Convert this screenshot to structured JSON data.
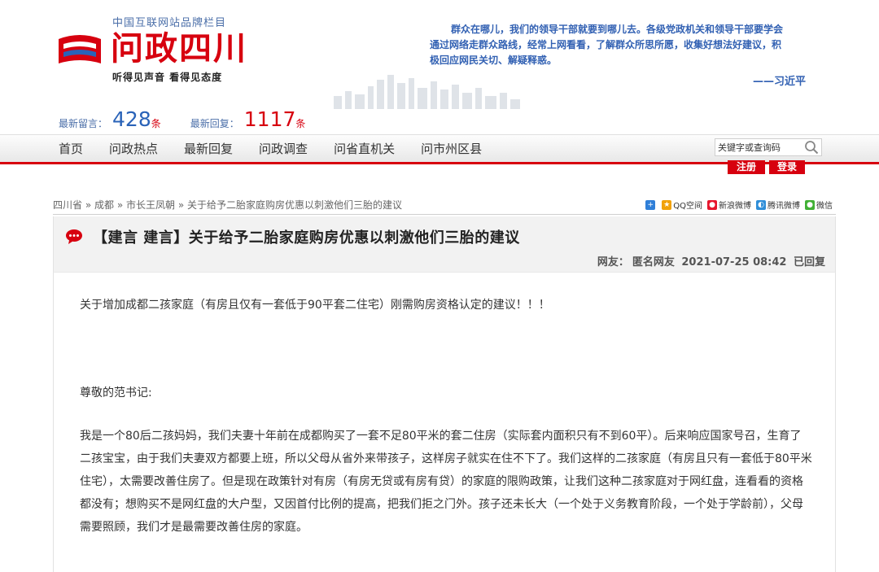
{
  "header": {
    "tagline_top": "中国互联网站品牌栏目",
    "logo_text": "问政四川",
    "slogan": "听得见声音  看得见态度",
    "quote_lines": [
      "群众在哪儿，我们的领导干部就要到哪儿去。各级党政机关和领导干部要学会",
      "通过网络走群众路线，经常上网看看，了解群众所思所愿，收集好想法好建议，积",
      "极回应网民关切、解疑释惑。"
    ],
    "quote_author": "——习近平",
    "stats": [
      {
        "label": "最新留言：",
        "value": "428",
        "unit": "条"
      },
      {
        "label": "最新回复：",
        "value": "1117",
        "unit": "条"
      }
    ]
  },
  "nav": {
    "items": [
      "首页",
      "问政热点",
      "最新回复",
      "问政调查",
      "问省直机关",
      "问市州区县"
    ],
    "search_placeholder": "关键字或查询码",
    "register_label": "注册",
    "login_label": "登录"
  },
  "breadcrumb": {
    "items": [
      "四川省",
      "成都",
      "市长王凤朝",
      "关于给予二胎家庭购房优惠以刺激他们三胎的建议"
    ],
    "separator": "»"
  },
  "share": {
    "items": [
      {
        "label": "",
        "color": "#2f7fd8",
        "icon": "plus-icon"
      },
      {
        "label": "QQ空间",
        "color": "#f1a20b",
        "icon": "qzone-icon"
      },
      {
        "label": "新浪微博",
        "color": "#e6162d",
        "icon": "weibo-icon"
      },
      {
        "label": "腾讯微博",
        "color": "#2f8ed8",
        "icon": "tencent-weibo-icon"
      },
      {
        "label": "微信",
        "color": "#41b035",
        "icon": "wechat-icon"
      }
    ]
  },
  "post": {
    "title": "【建言 建言】关于给予二胎家庭购房优惠以刺激他们三胎的建议",
    "meta_label": "网友：",
    "author": "匿名网友",
    "datetime": "2021-07-25 08:42",
    "status": "已回复",
    "paragraphs": [
      "关于增加成都二孩家庭（有房且仅有一套低于90平套二住宅）刚需购房资格认定的建议！！！",
      "尊敬的范书记:",
      "我是一个80后二孩妈妈，我们夫妻十年前在成都购买了一套不足80平米的套二住房（实际套内面积只有不到60平）。后来响应国家号召，生育了二孩宝宝，由于我们夫妻双方都要上班，所以父母从省外来带孩子，这样房子就实在住不下了。我们这样的二孩家庭（有房且只有一套低于80平米住宅），太需要改善住房了。但是现在政策针对有房（有房无贷或有房有贷）的家庭的限购政策，让我们这种二孩家庭对于网红盘，连看看的资格都没有；想购买不是网红盘的大户型，又因首付比例的提高，把我们拒之门外。孩子还未长大（一个处于义务教育阶段，一个处于学龄前），父母需要照顾，我们才是最需要改善住房的家庭。"
    ]
  }
}
